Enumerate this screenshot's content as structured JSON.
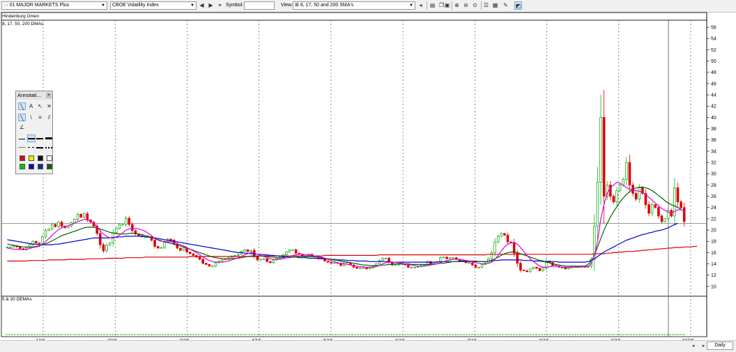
{
  "toolbar": {
    "watchlist": "01 MAJOR MARKETS Plus",
    "security": "CBOE Volatility Index",
    "symbol_label": "Symbol:",
    "symbol_value": "",
    "view_label": "View:",
    "view_value": "8, 17, 50 and 200 SMA's"
  },
  "panes": {
    "top_label": "Hindenburg Omen",
    "main_label": "8, 17, 50, 200 DMAs",
    "lower_label": "5 & 20 DEMAs"
  },
  "annotation": {
    "title": "Annotati...",
    "tools": [
      "A"
    ],
    "colors": [
      "#d01010",
      "#f4e800",
      "#101010",
      "#ffffff",
      "#10c010",
      "#101090",
      "#103090",
      "#106010"
    ]
  },
  "footer": {
    "period": "Daily"
  },
  "chart_data": {
    "type": "candlestick",
    "title": "",
    "x_labels": [
      "1/15",
      "2/15",
      "3/15",
      "4/15",
      "5/15",
      "6/15",
      "7/15",
      "8/15",
      "9/15",
      "10/15"
    ],
    "y_ticks": [
      10,
      12,
      14,
      16,
      18,
      20,
      22,
      24,
      26,
      28,
      30,
      32,
      34,
      36,
      38,
      40,
      42,
      44,
      46,
      48,
      50,
      52,
      54,
      56
    ],
    "ylim": [
      8.5,
      57
    ],
    "horizontal_line": 21.2,
    "colors": {
      "up": "#18b018",
      "down": "#e00000",
      "sma8": "#e000e0",
      "sma17": "#006000",
      "sma50": "#0000d0",
      "sma200": "#e00000"
    },
    "close": [
      17.0,
      17.0,
      17.2,
      17.0,
      16.7,
      16.5,
      16.9,
      17.4,
      18.0,
      17.7,
      17.6,
      18.8,
      19.9,
      20.2,
      21.0,
      20.6,
      21.4,
      20.7,
      20.4,
      20.7,
      21.3,
      21.9,
      22.8,
      22.3,
      22.9,
      21.8,
      21.4,
      20.7,
      19.4,
      17.4,
      16.3,
      17.3,
      17.7,
      19.5,
      20.3,
      21.0,
      21.0,
      22.1,
      21.0,
      19.9,
      19.3,
      19.0,
      18.8,
      18.8,
      18.8,
      18.2,
      17.1,
      16.8,
      16.9,
      17.8,
      18.4,
      18.2,
      17.5,
      16.8,
      16.4,
      16.8,
      16.1,
      15.8,
      15.5,
      15.2,
      14.8,
      14.1,
      13.9,
      13.6,
      13.6,
      14.2,
      14.5,
      14.9,
      14.8,
      15.1,
      15.4,
      15.5,
      15.7,
      16.2,
      16.5,
      16.2,
      16.4,
      15.3,
      14.7,
      14.8,
      14.9,
      14.4,
      14.2,
      14.7,
      15.0,
      15.2,
      15.6,
      16.1,
      16.5,
      16.5,
      15.9,
      15.7,
      15.3,
      15.3,
      15.7,
      15.3,
      15.4,
      15.0,
      14.9,
      14.5,
      14.3,
      14.1,
      14.2,
      14.1,
      13.7,
      14.3,
      14.2,
      13.8,
      13.4,
      13.2,
      13.3,
      13.3,
      13.1,
      13.3,
      13.6,
      14.0,
      14.6,
      15.0,
      15.0,
      14.3,
      13.8,
      13.9,
      13.9,
      14.0,
      13.8,
      13.4,
      13.4,
      13.4,
      13.5,
      13.7,
      13.8,
      14.4,
      14.0,
      14.3,
      14.4,
      15.1,
      15.2,
      14.9,
      15.1,
      15.1,
      14.8,
      14.6,
      14.5,
      14.2,
      14.2,
      13.8,
      13.4,
      13.4,
      13.9,
      14.2,
      14.9,
      16.0,
      17.9,
      18.9,
      19.4,
      19.1,
      17.9,
      17.8,
      15.9,
      14.1,
      12.9,
      12.8,
      12.6,
      13.1,
      13.4,
      13.2,
      12.8,
      13.3,
      14.5,
      14.2,
      13.7,
      13.6,
      13.4,
      13.3,
      13.1,
      13.3,
      13.6,
      13.6,
      13.4,
      13.6,
      13.4,
      13.6,
      14.8,
      20.7,
      28.5,
      40.0,
      26.0,
      28.0,
      26.0,
      25.0,
      27.0,
      28.0,
      29.0,
      32.0,
      28.0,
      26.5,
      25.5,
      27.5,
      26.5,
      24.5,
      23.0,
      24.5,
      24.0,
      22.5,
      21.5,
      22.0,
      23.5,
      22.5,
      27.5,
      25.0,
      24.0,
      21.5
    ],
    "sma8": [
      16.8,
      16.7,
      16.6,
      16.6,
      16.5,
      16.5,
      16.6,
      16.7,
      16.9,
      17.0,
      17.1,
      17.5,
      18.0,
      18.5,
      19.1,
      19.6,
      20.1,
      20.4,
      20.6,
      20.8,
      21.0,
      21.2,
      21.5,
      21.7,
      21.9,
      21.8,
      21.6,
      21.2,
      20.6,
      19.9,
      19.3,
      18.9,
      18.6,
      18.6,
      18.8,
      19.1,
      19.5,
      20.0,
      20.2,
      20.3,
      20.3,
      20.2,
      20.0,
      19.8,
      19.4,
      19.0,
      18.5,
      18.2,
      18.0,
      18.0,
      17.9,
      17.9,
      17.8,
      17.6,
      17.4,
      17.2,
      16.9,
      16.6,
      16.3,
      16.0,
      15.6,
      15.2,
      14.9,
      14.6,
      14.4,
      14.3,
      14.3,
      14.3,
      14.4,
      14.5,
      14.7,
      14.9,
      15.1,
      15.3,
      15.6,
      15.8,
      16.0,
      15.9,
      15.7,
      15.5,
      15.3,
      15.1,
      14.9,
      14.8,
      14.8,
      14.8,
      14.9,
      15.1,
      15.3,
      15.5,
      15.6,
      15.7,
      15.7,
      15.6,
      15.6,
      15.5,
      15.4,
      15.3,
      15.2,
      15.0,
      14.8,
      14.6,
      14.4,
      14.2,
      14.1,
      14.0,
      13.9,
      13.8,
      13.7,
      13.6,
      13.5,
      13.5,
      13.4,
      13.4,
      13.4,
      13.5,
      13.7,
      14.0,
      14.2,
      14.3,
      14.3,
      14.3,
      14.2,
      14.1,
      14.0,
      13.9,
      13.8,
      13.7,
      13.6,
      13.6,
      13.6,
      13.7,
      13.8,
      13.9,
      14.0,
      14.2,
      14.4,
      14.6,
      14.7,
      14.8,
      14.8,
      14.8,
      14.7,
      14.6,
      14.5,
      14.4,
      14.2,
      14.1,
      14.0,
      14.0,
      14.1,
      14.3,
      14.8,
      15.5,
      16.3,
      17.0,
      17.5,
      17.7,
      17.8,
      17.5,
      16.9,
      16.2,
      15.5,
      14.9,
      14.4,
      14.0,
      13.6,
      13.4,
      13.4,
      13.5,
      13.6,
      13.6,
      13.5,
      13.4,
      13.4,
      13.4,
      13.4,
      13.4,
      13.4,
      13.5,
      13.5,
      13.5,
      14.0,
      15.5,
      18.0,
      22.0,
      24.5,
      26.5,
      27.5,
      28.0,
      28.5,
      28.3,
      28.0,
      27.5,
      27.3,
      27.1,
      27.0,
      26.9,
      26.7,
      26.3,
      25.8,
      25.3,
      24.8,
      24.3,
      23.8,
      23.5,
      23.2,
      23.0,
      23.3,
      23.6,
      23.6,
      23.4
    ],
    "sma17": [
      17.5,
      17.4,
      17.3,
      17.2,
      17.1,
      17.0,
      17.0,
      17.0,
      17.0,
      17.1,
      17.2,
      17.4,
      17.6,
      17.8,
      18.1,
      18.4,
      18.7,
      19.0,
      19.2,
      19.4,
      19.6,
      19.8,
      20.0,
      20.2,
      20.4,
      20.5,
      20.5,
      20.5,
      20.4,
      20.2,
      20.0,
      19.8,
      19.6,
      19.5,
      19.4,
      19.3,
      19.3,
      19.3,
      19.4,
      19.4,
      19.4,
      19.3,
      19.2,
      19.0,
      18.9,
      18.7,
      18.5,
      18.3,
      18.1,
      17.9,
      17.8,
      17.6,
      17.5,
      17.3,
      17.2,
      17.0,
      16.8,
      16.6,
      16.4,
      16.2,
      16.0,
      15.8,
      15.6,
      15.4,
      15.2,
      15.1,
      15.0,
      14.9,
      14.9,
      14.9,
      14.9,
      15.0,
      15.0,
      15.1,
      15.2,
      15.3,
      15.4,
      15.4,
      15.4,
      15.4,
      15.3,
      15.3,
      15.2,
      15.2,
      15.1,
      15.1,
      15.1,
      15.1,
      15.1,
      15.2,
      15.2,
      15.3,
      15.3,
      15.3,
      15.3,
      15.3,
      15.2,
      15.2,
      15.1,
      15.0,
      14.9,
      14.8,
      14.7,
      14.6,
      14.5,
      14.4,
      14.3,
      14.2,
      14.1,
      14.0,
      13.9,
      13.8,
      13.8,
      13.7,
      13.7,
      13.7,
      13.7,
      13.8,
      13.8,
      13.9,
      13.9,
      14.0,
      14.0,
      14.0,
      14.0,
      14.0,
      13.9,
      13.9,
      13.9,
      13.9,
      13.9,
      13.9,
      13.9,
      14.0,
      14.0,
      14.1,
      14.1,
      14.2,
      14.3,
      14.4,
      14.4,
      14.5,
      14.5,
      14.5,
      14.5,
      14.5,
      14.5,
      14.4,
      14.4,
      14.4,
      14.5,
      14.6,
      14.9,
      15.2,
      15.5,
      15.8,
      16.0,
      16.1,
      16.1,
      16.0,
      15.8,
      15.6,
      15.4,
      15.2,
      15.0,
      14.8,
      14.6,
      14.5,
      14.3,
      14.2,
      14.0,
      13.9,
      13.8,
      13.7,
      13.6,
      13.6,
      13.6,
      13.6,
      13.6,
      13.6,
      13.6,
      13.9,
      14.5,
      15.5,
      17.0,
      18.5,
      20.0,
      21.2,
      22.3,
      23.3,
      24.1,
      25.0,
      25.7,
      26.3,
      26.8,
      27.2,
      27.5,
      27.6,
      27.6,
      27.5,
      27.3,
      27.0,
      26.6,
      26.1,
      25.7,
      25.2,
      24.8,
      24.5,
      24.3,
      24.0,
      23.7
    ],
    "sma50": [
      18.3,
      18.2,
      18.1,
      18.0,
      17.9,
      17.8,
      17.7,
      17.6,
      17.5,
      17.5,
      17.4,
      17.4,
      17.4,
      17.4,
      17.4,
      17.5,
      17.5,
      17.6,
      17.7,
      17.8,
      17.9,
      18.0,
      18.1,
      18.2,
      18.3,
      18.4,
      18.5,
      18.6,
      18.6,
      18.6,
      18.6,
      18.6,
      18.6,
      18.7,
      18.7,
      18.8,
      18.8,
      18.9,
      18.9,
      18.9,
      18.9,
      18.9,
      18.9,
      18.8,
      18.8,
      18.7,
      18.6,
      18.5,
      18.4,
      18.3,
      18.2,
      18.1,
      18.0,
      17.9,
      17.8,
      17.7,
      17.6,
      17.5,
      17.4,
      17.3,
      17.2,
      17.1,
      17.0,
      16.9,
      16.8,
      16.7,
      16.6,
      16.5,
      16.4,
      16.3,
      16.2,
      16.1,
      16.0,
      16.0,
      15.9,
      15.9,
      15.8,
      15.8,
      15.7,
      15.7,
      15.6,
      15.6,
      15.5,
      15.5,
      15.4,
      15.4,
      15.3,
      15.3,
      15.2,
      15.2,
      15.2,
      15.1,
      15.1,
      15.1,
      15.0,
      15.0,
      15.0,
      14.9,
      14.9,
      14.9,
      14.8,
      14.8,
      14.8,
      14.7,
      14.7,
      14.7,
      14.6,
      14.6,
      14.6,
      14.5,
      14.5,
      14.5,
      14.5,
      14.4,
      14.4,
      14.4,
      14.4,
      14.4,
      14.4,
      14.4,
      14.3,
      14.3,
      14.3,
      14.3,
      14.3,
      14.3,
      14.3,
      14.3,
      14.3,
      14.3,
      14.3,
      14.3,
      14.3,
      14.3,
      14.3,
      14.4,
      14.4,
      14.4,
      14.4,
      14.4,
      14.4,
      14.4,
      14.4,
      14.4,
      14.4,
      14.4,
      14.4,
      14.4,
      14.4,
      14.4,
      14.5,
      14.5,
      14.6,
      14.6,
      14.7,
      14.7,
      14.7,
      14.7,
      14.7,
      14.7,
      14.7,
      14.6,
      14.6,
      14.6,
      14.5,
      14.5,
      14.5,
      14.4,
      14.4,
      14.4,
      14.4,
      14.4,
      14.3,
      14.3,
      14.3,
      14.3,
      14.3,
      14.3,
      14.3,
      14.3,
      14.3,
      14.4,
      14.6,
      14.9,
      15.3,
      15.7,
      16.1,
      16.4,
      16.7,
      17.0,
      17.3,
      17.6,
      17.9,
      18.2,
      18.4,
      18.6,
      18.8,
      19.0,
      19.2,
      19.3,
      19.5,
      19.6,
      19.8,
      19.9,
      20.0,
      20.2,
      20.4,
      20.7,
      21.0,
      21.2
    ],
    "sma200": [
      14.5,
      14.5,
      14.5,
      14.5,
      14.5,
      14.5,
      14.5,
      14.6,
      14.6,
      14.6,
      14.6,
      14.6,
      14.6,
      14.7,
      14.7,
      14.7,
      14.7,
      14.7,
      14.7,
      14.8,
      14.8,
      14.8,
      14.8,
      14.8,
      14.8,
      14.9,
      14.9,
      14.9,
      14.9,
      14.9,
      14.9,
      15.0,
      15.0,
      15.0,
      15.0,
      15.0,
      15.0,
      15.1,
      15.1,
      15.1,
      15.1,
      15.1,
      15.1,
      15.2,
      15.2,
      15.2,
      15.2,
      15.2,
      15.2,
      15.2,
      15.2,
      15.2,
      15.2,
      15.2,
      15.2,
      15.2,
      15.2,
      15.3,
      15.3,
      15.3,
      15.3,
      15.3,
      15.3,
      15.3,
      15.3,
      15.3,
      15.3,
      15.3,
      15.3,
      15.3,
      15.3,
      15.3,
      15.3,
      15.3,
      15.3,
      15.3,
      15.3,
      15.3,
      15.3,
      15.4,
      15.4,
      15.4,
      15.4,
      15.4,
      15.4,
      15.4,
      15.4,
      15.4,
      15.4,
      15.4,
      15.4,
      15.4,
      15.4,
      15.4,
      15.4,
      15.4,
      15.4,
      15.4,
      15.4,
      15.5,
      15.5,
      15.5,
      15.5,
      15.5,
      15.5,
      15.5,
      15.5,
      15.5,
      15.5,
      15.5,
      15.5,
      15.5,
      15.5,
      15.5,
      15.5,
      15.5,
      15.6,
      15.6,
      15.6,
      15.6,
      15.6,
      15.6,
      15.6,
      15.6,
      15.6,
      15.6,
      15.6,
      15.6,
      15.6,
      15.6,
      15.6,
      15.6,
      15.6,
      15.6,
      15.6,
      15.6,
      15.6,
      15.6,
      15.6,
      15.6,
      15.6,
      15.6,
      15.6,
      15.6,
      15.6,
      15.6,
      15.6,
      15.6,
      15.6,
      15.6,
      15.7,
      15.7,
      15.7,
      15.7,
      15.7,
      15.7,
      15.7,
      15.7,
      15.7,
      15.7,
      15.7,
      15.7,
      15.7,
      15.7,
      15.7,
      15.7,
      15.7,
      15.7,
      15.7,
      15.7,
      15.7,
      15.7,
      15.7,
      15.7,
      15.7,
      15.7,
      15.7,
      15.7,
      15.7,
      15.7,
      15.7,
      15.7,
      15.7,
      15.8,
      15.8,
      15.8,
      15.8,
      15.9,
      15.9,
      16.0,
      16.0,
      16.1,
      16.1,
      16.2,
      16.2,
      16.2,
      16.3,
      16.3,
      16.4,
      16.4,
      16.5,
      16.5,
      16.6,
      16.6,
      16.7,
      16.7,
      16.8,
      16.8,
      16.9,
      16.9,
      16.9,
      17.0,
      17.0,
      17.0,
      17.1,
      17.1
    ]
  }
}
